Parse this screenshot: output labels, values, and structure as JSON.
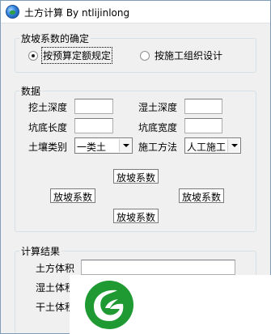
{
  "window": {
    "title": "土方计算 By ntlijinlong"
  },
  "group_method": {
    "legend": "放坡系数的确定",
    "options": [
      {
        "label": "按预算定额规定",
        "checked": true
      },
      {
        "label": "按施工组织设计",
        "checked": false
      }
    ]
  },
  "group_data": {
    "legend": "数据",
    "labels": {
      "dig_depth": "挖土深度",
      "wet_depth": "湿土深度",
      "pit_length": "坑底长度",
      "pit_width": "坑底宽度",
      "soil_type": "土壤类别",
      "construction": "施工方法"
    },
    "values": {
      "dig_depth": "",
      "wet_depth": "",
      "pit_length": "",
      "pit_width": ""
    },
    "selects": {
      "soil_type": "一类土",
      "construction": "人工施工"
    },
    "coef_label": "放坡系数"
  },
  "group_result": {
    "legend": "计算结果",
    "labels": {
      "volume": "土方体积",
      "wet_volume": "湿土体积",
      "dry_volume": "干土体积"
    },
    "values": {
      "volume": ""
    }
  },
  "icons": [
    "globe-icon",
    "dropdown-arrow-icon",
    "leaf-logo-icon"
  ],
  "colors": {
    "logo_green": "#1f9a33",
    "window_bg": "#f0f0f0"
  }
}
